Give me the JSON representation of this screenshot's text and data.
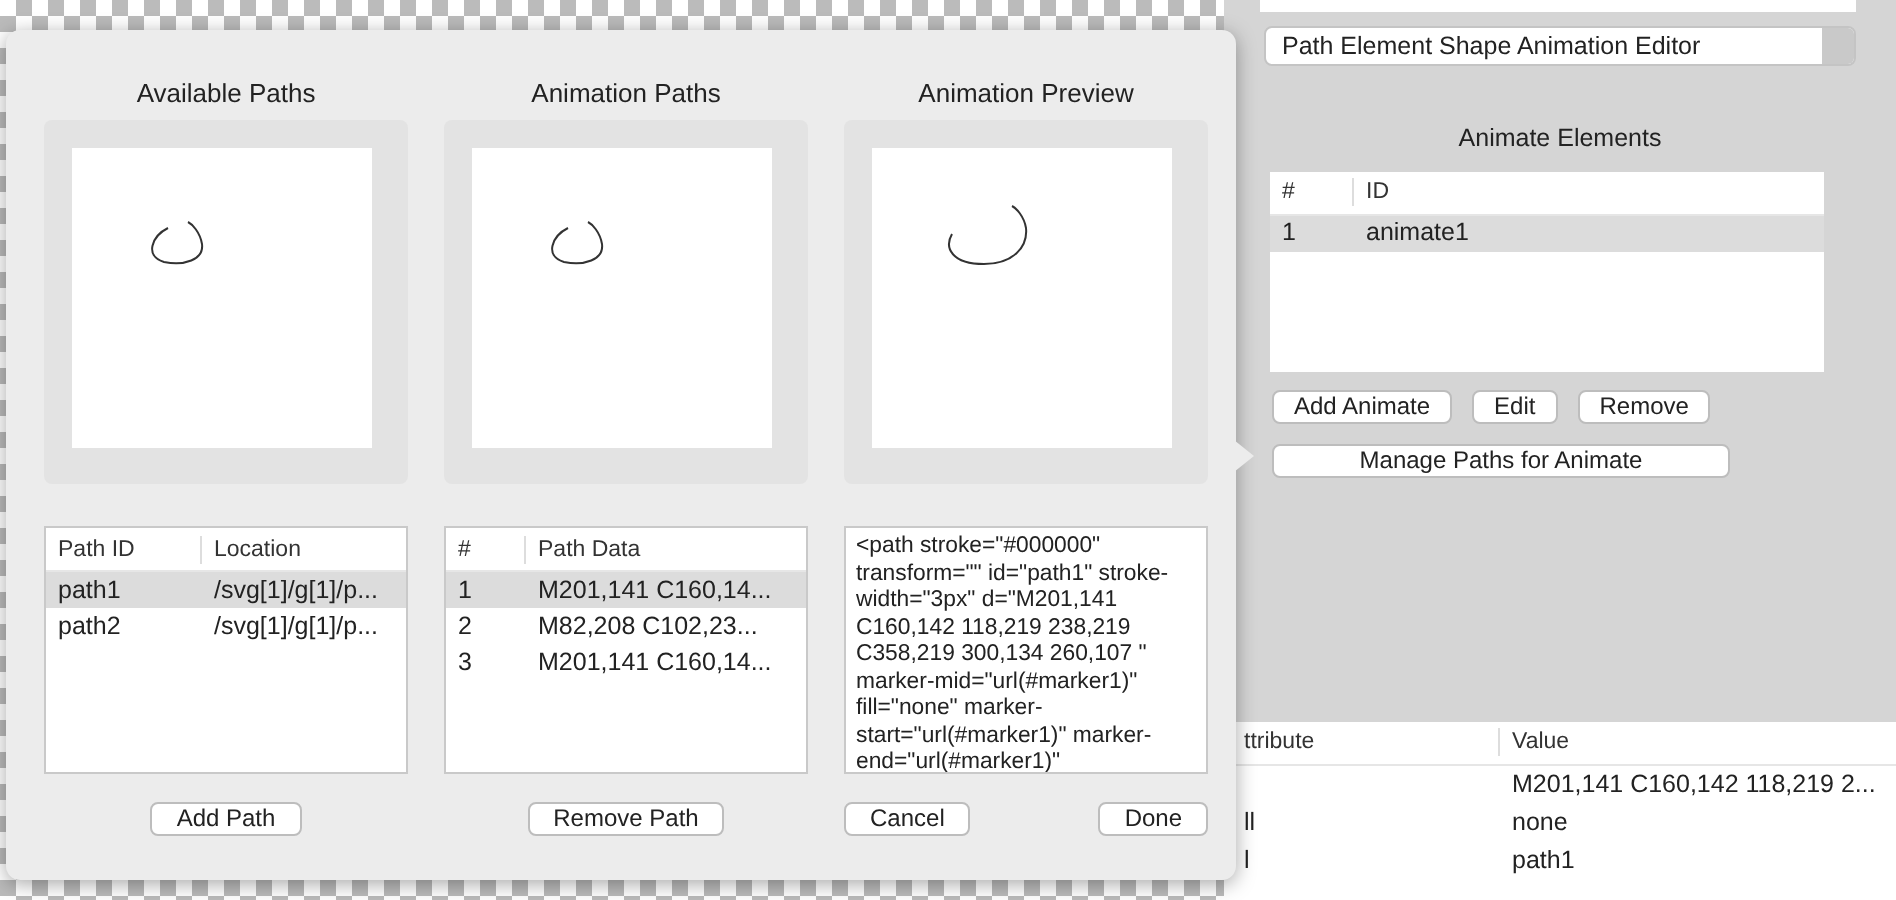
{
  "dialog": {
    "panels": [
      {
        "kind": "available",
        "title": "Available Paths",
        "table": {
          "columns": [
            "Path ID",
            "Location"
          ],
          "rows": [
            {
              "cells": [
                "path1",
                "/svg[1]/g[1]/p..."
              ],
              "selected": true
            },
            {
              "cells": [
                "path2",
                "/svg[1]/g[1]/p..."
              ],
              "selected": false
            }
          ]
        },
        "buttons": [
          "Add Path"
        ]
      },
      {
        "kind": "animation",
        "title": "Animation Paths",
        "table": {
          "columns": [
            "#",
            "Path Data"
          ],
          "rows": [
            {
              "cells": [
                "1",
                "M201,141 C160,14..."
              ],
              "selected": true
            },
            {
              "cells": [
                "2",
                "M82,208 C102,23..."
              ],
              "selected": false
            },
            {
              "cells": [
                "3",
                "M201,141 C160,14..."
              ],
              "selected": false
            }
          ]
        },
        "buttons": [
          "Remove Path"
        ]
      },
      {
        "kind": "preview",
        "title": "Animation Preview",
        "source": "<path stroke=\"#000000\" transform=\"\" id=\"path1\" stroke-width=\"3px\" d=\"M201,141 C160,142 118,219 238,219 C358,219 300,134 260,107 \" marker-mid=\"url(#marker1)\" fill=\"none\" marker-start=\"url(#marker1)\" marker-end=\"url(#marker1)\"",
        "buttons": [
          "Cancel",
          "Done"
        ]
      }
    ]
  },
  "inspector": {
    "editor_select": "Path Element Shape Animation Editor",
    "animate_elements": {
      "title": "Animate Elements",
      "columns": [
        "#",
        "ID"
      ],
      "rows": [
        {
          "cells": [
            "1",
            "animate1"
          ],
          "selected": true
        }
      ]
    },
    "buttons": [
      "Add Animate",
      "Edit",
      "Remove"
    ],
    "manage_button": "Manage Paths for Animate",
    "attributes": {
      "columns": [
        "ttribute",
        "Value"
      ],
      "rows": [
        {
          "value": "M201,141 C160,142 118,219 2..."
        },
        {
          "attribute": "ll",
          "value": "none"
        },
        {
          "attribute": "l",
          "value": "path1"
        }
      ]
    }
  }
}
